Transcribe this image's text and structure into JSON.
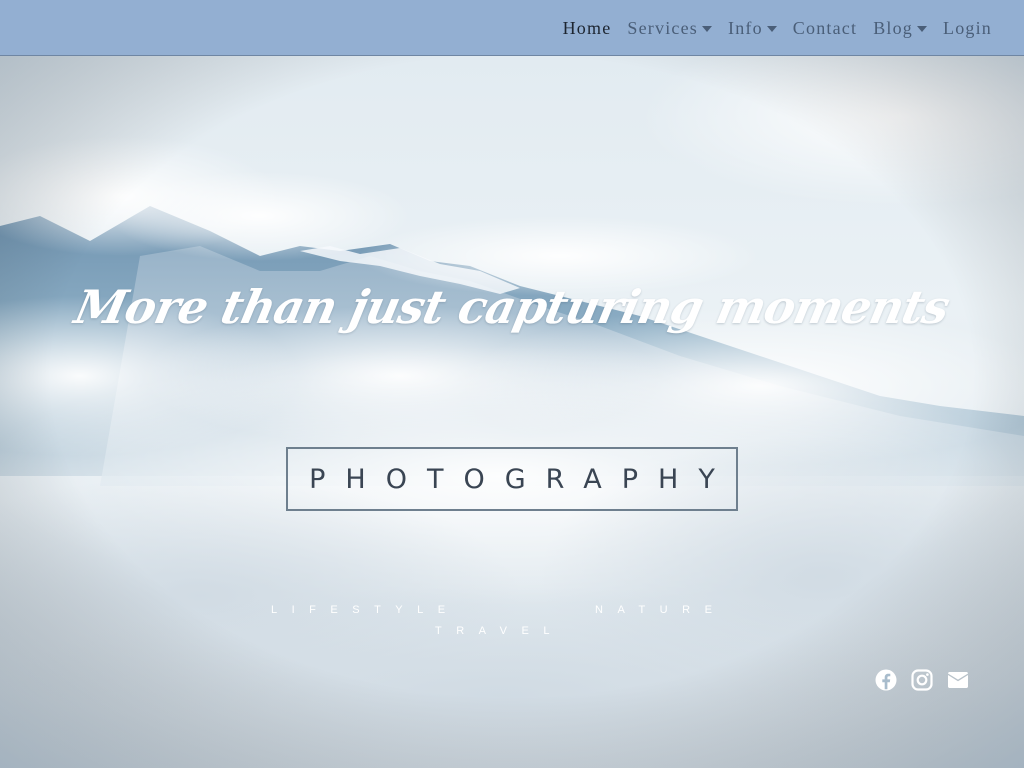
{
  "nav": {
    "items": [
      {
        "label": "Home",
        "active": true,
        "dropdown": false
      },
      {
        "label": "Services",
        "active": false,
        "dropdown": true
      },
      {
        "label": "Info",
        "active": false,
        "dropdown": true
      },
      {
        "label": "Contact",
        "active": false,
        "dropdown": false
      },
      {
        "label": "Blog",
        "active": false,
        "dropdown": true
      },
      {
        "label": "Login",
        "active": false,
        "dropdown": false
      }
    ]
  },
  "hero": {
    "headline": "More than just capturing moments",
    "photography_label": "PHOTOGRAPHY",
    "tags": {
      "lifestyle": "LIFESTYLE",
      "nature": "NATURE",
      "travel": "TRAVEL"
    },
    "social_icons": [
      "facebook-icon",
      "instagram-icon",
      "envelope-icon"
    ]
  },
  "colors": {
    "navbar": "#93afd2",
    "nav_text": "#4a5e78",
    "nav_active": "#1d2530",
    "headline": "#ffffff",
    "photo_box_text": "#3a4553"
  }
}
